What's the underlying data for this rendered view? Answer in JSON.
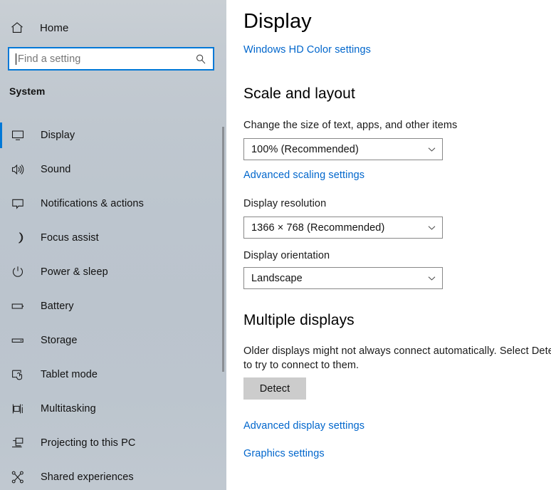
{
  "sidebar": {
    "home": {
      "label": "Home",
      "icon": "home-icon"
    },
    "search": {
      "placeholder": "Find a setting",
      "value": "",
      "icon": "search-icon"
    },
    "group_title": "System",
    "items": [
      {
        "label": "Display",
        "icon": "monitor-icon",
        "selected": true
      },
      {
        "label": "Sound",
        "icon": "speaker-icon",
        "selected": false
      },
      {
        "label": "Notifications & actions",
        "icon": "notification-icon",
        "selected": false
      },
      {
        "label": "Focus assist",
        "icon": "moon-icon",
        "selected": false
      },
      {
        "label": "Power & sleep",
        "icon": "power-icon",
        "selected": false
      },
      {
        "label": "Battery",
        "icon": "battery-icon",
        "selected": false
      },
      {
        "label": "Storage",
        "icon": "storage-icon",
        "selected": false
      },
      {
        "label": "Tablet mode",
        "icon": "tablet-icon",
        "selected": false
      },
      {
        "label": "Multitasking",
        "icon": "multitasking-icon",
        "selected": false
      },
      {
        "label": "Projecting to this PC",
        "icon": "projecting-icon",
        "selected": false
      },
      {
        "label": "Shared experiences",
        "icon": "share-icon",
        "selected": false
      }
    ]
  },
  "main": {
    "title": "Display",
    "hd_color_link": "Windows HD Color settings",
    "scale_section": {
      "heading": "Scale and layout",
      "scale_label": "Change the size of text, apps, and other items",
      "scale_value": "100% (Recommended)",
      "advanced_scaling_link": "Advanced scaling settings",
      "resolution_label": "Display resolution",
      "resolution_value": "1366 × 768 (Recommended)",
      "orientation_label": "Display orientation",
      "orientation_value": "Landscape"
    },
    "multiple_displays": {
      "heading": "Multiple displays",
      "description": "Older displays might not always connect automatically. Select Detect to try to connect to them.",
      "detect_button": "Detect"
    },
    "advanced_display_link": "Advanced display settings",
    "graphics_link": "Graphics settings"
  },
  "colors": {
    "accent": "#0078d7",
    "link": "#0066cc",
    "sidebar_bg": "#bfc7cf",
    "button_bg": "#cccccc"
  }
}
